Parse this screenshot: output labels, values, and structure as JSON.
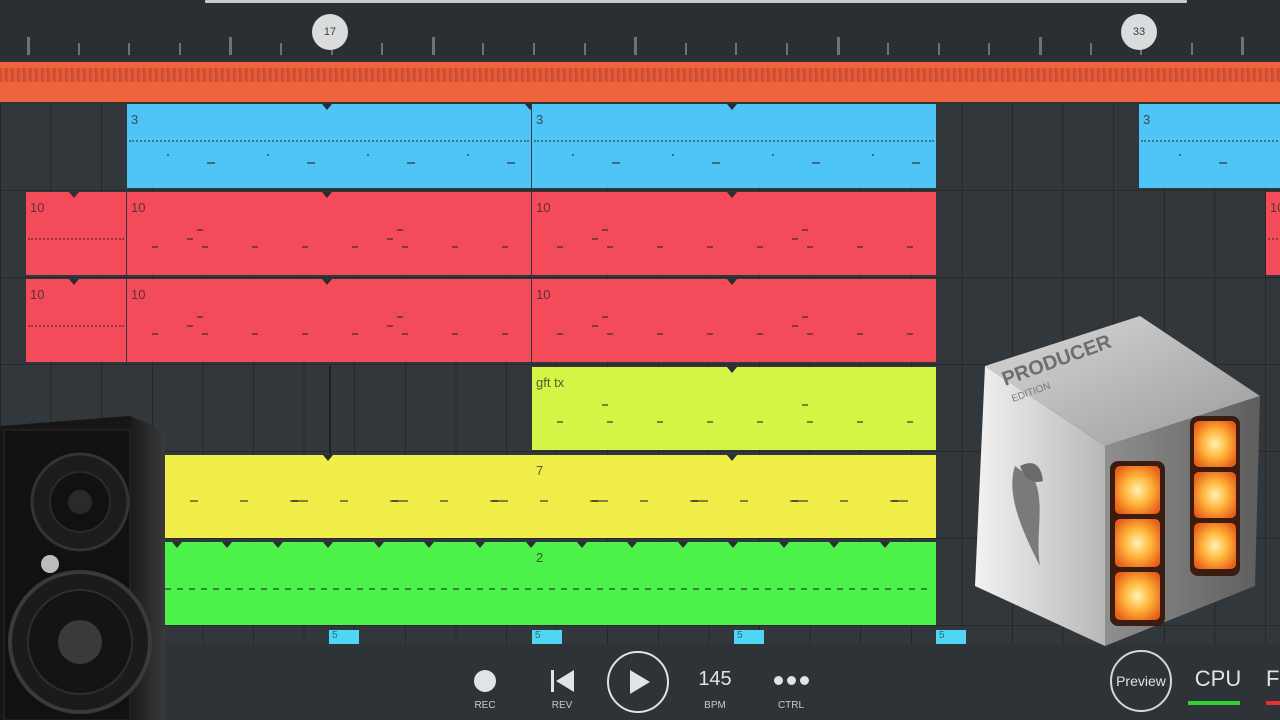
{
  "timeline": {
    "markers": [
      {
        "label": "17"
      },
      {
        "label": "33"
      }
    ]
  },
  "clips": [
    {
      "id": "c1",
      "label": "3",
      "color": "#4fc4f7"
    },
    {
      "id": "c2",
      "label": "3",
      "color": "#4fc4f7"
    },
    {
      "id": "c3",
      "label": "3",
      "color": "#4fc4f7"
    },
    {
      "id": "c4",
      "label": "10",
      "color": "#f44b5a"
    },
    {
      "id": "c5",
      "label": "10",
      "color": "#f44b5a"
    },
    {
      "id": "c6",
      "label": "10",
      "color": "#f44b5a"
    },
    {
      "id": "c7",
      "label": "10",
      "color": "#f44b5a"
    },
    {
      "id": "c8",
      "label": "10",
      "color": "#f44b5a"
    },
    {
      "id": "c9",
      "label": "10",
      "color": "#f44b5a"
    },
    {
      "id": "c10",
      "label": "10",
      "color": "#f44b5a"
    },
    {
      "id": "c11",
      "label": "gft tx",
      "color": "#d4f545"
    },
    {
      "id": "c12",
      "label": "7",
      "color": "#f1ee4a"
    },
    {
      "id": "c13",
      "label": "2",
      "color": "#4cf24a"
    }
  ],
  "mini_clips": [
    "5",
    "5",
    "5",
    "5"
  ],
  "transport": {
    "rec": "REC",
    "rev": "REV",
    "bpm_value": "145",
    "bpm_label": "BPM",
    "ctrl": "CTRL",
    "preview": "Preview",
    "cpu": "CPU",
    "cut_label": "F"
  },
  "overlay": {
    "cube_text_1": "PRODUCER",
    "cube_text_2": "EDITION"
  },
  "colors": {
    "overview": "#f0643d",
    "cpu_green": "#2fd32f",
    "cpu_red": "#e83030"
  }
}
